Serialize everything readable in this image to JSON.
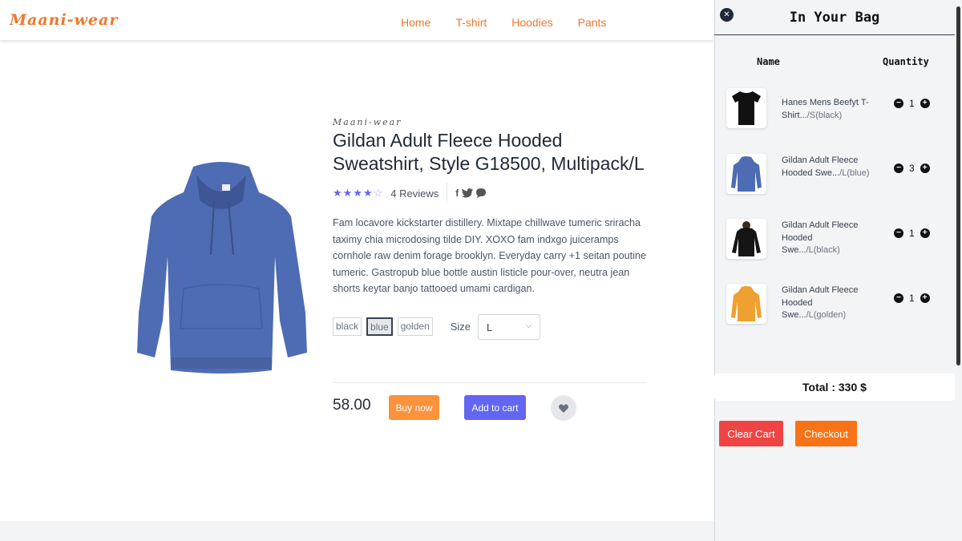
{
  "header": {
    "logo": "Maani-wear",
    "nav": [
      "Home",
      "T-shirt",
      "Hoodies",
      "Pants"
    ]
  },
  "product": {
    "brand": "Maani-wear",
    "title": "Gildan Adult Fleece Hooded Sweatshirt, Style G18500, Multipack/L",
    "rating": 4,
    "rating_max": 5,
    "reviews": "4 Reviews",
    "description": "Fam locavore kickstarter distillery. Mixtape chillwave tumeric sriracha taximy chia microdosing tilde DIY. XOXO fam indxgo juiceramps cornhole raw denim forage brooklyn. Everyday carry +1 seitan poutine tumeric. Gastropub blue bottle austin listicle pour-over, neutra jean shorts keytar banjo tattooed umami cardigan.",
    "colors": [
      "black",
      "blue",
      "golden"
    ],
    "selected_color": "blue",
    "size_label": "Size",
    "size_value": "L",
    "price": "58.00",
    "buy_label": "Buy now",
    "cart_label": "Add to cart",
    "image_color": "#4e6cb3"
  },
  "cart": {
    "title": "In Your Bag",
    "col_name": "Name",
    "col_quantity": "Quantity",
    "items": [
      {
        "name": "Hanes Mens Beefyt T-Shirt...",
        "variant": "/S(black)",
        "qty": "1",
        "color": "#111111"
      },
      {
        "name": "Gildan Adult Fleece Hooded Swe...",
        "variant": "/L(blue)",
        "qty": "3",
        "color": "#4e6cb3"
      },
      {
        "name": "Gildan Adult Fleece Hooded Swe...",
        "variant": "/L(black)",
        "qty": "1",
        "color": "#151515"
      },
      {
        "name": "Gildan Adult Fleece Hooded Swe...",
        "variant": "/L(golden)",
        "qty": "1",
        "color": "#f0a030"
      }
    ],
    "total": "Total : 330 $",
    "clear_label": "Clear Cart",
    "checkout_label": "Checkout"
  },
  "icons": {
    "close": "close-icon",
    "heart": "heart-icon",
    "minus": "minus-icon",
    "plus": "plus-icon",
    "chevron": "chevron-down-icon",
    "facebook": "facebook-icon",
    "twitter": "twitter-icon",
    "chat": "chat-icon"
  },
  "colors": {
    "accent": "#f0772e",
    "primary": "#6366f1",
    "buy": "#fb923c",
    "clear": "#ef4444",
    "checkout": "#f97316"
  }
}
